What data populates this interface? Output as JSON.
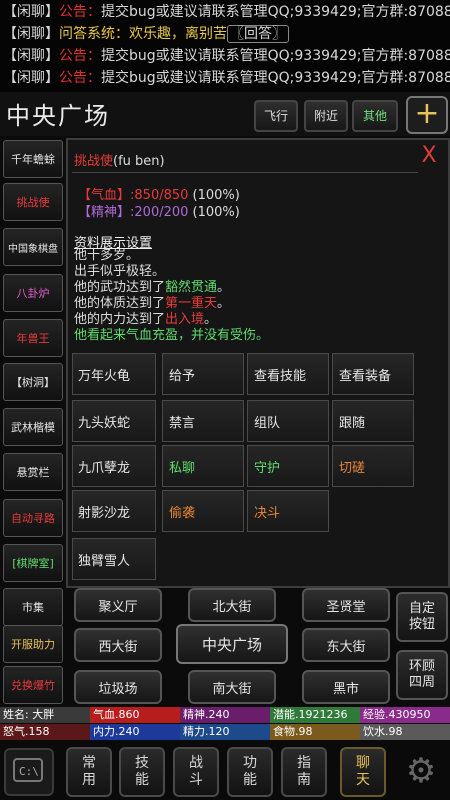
{
  "chat": [
    {
      "tag": "【闲聊】",
      "label": "公告：",
      "text": "提交bug或建议请联系管理QQ;9339429;官方群:87088"
    },
    {
      "tag": "【闲聊】",
      "label": "问答系统：",
      "text": "欢乐趣，离别苦",
      "highlight": "〖回答〗"
    },
    {
      "tag": "【闲聊】",
      "label": "公告：",
      "text": "提交bug或建议请联系管理QQ;9339429;官方群:87088"
    },
    {
      "tag": "【闲聊】",
      "label": "公告：",
      "text": "提交bug或建议请联系管理QQ;9339429;官方群:87088"
    }
  ],
  "location": {
    "title": "中央广场"
  },
  "header_buttons": {
    "fly": "飞行",
    "nearby": "附近",
    "other": "其他",
    "plus": "+"
  },
  "sidebar": [
    "千年蟾蜍",
    "挑战使",
    "中国象棋盘",
    "八卦炉",
    "年兽王",
    "【树洞】",
    "武林楷模",
    "悬赏栏",
    "自动寻路",
    "[棋牌室]",
    "市集",
    "开服助力",
    "兑换爆竹"
  ],
  "panel": {
    "close": "X",
    "npc_name": "挑战使",
    "npc_id": "(fu ben)",
    "hp_label": "【气血】",
    "hp_value": ":850/850",
    "hp_pct": "(100%)",
    "mp_label": "【精神】",
    "mp_value": ":200/200",
    "mp_pct": "(100%)",
    "profile_link": "资料展示设置",
    "info": [
      {
        "pre": "他十多岁。",
        "em": "",
        "post": ""
      },
      {
        "pre": "出手似乎极轻。",
        "em": "",
        "post": ""
      },
      {
        "pre": "他的武功达到了",
        "em": "豁然贯通",
        "post": "。"
      },
      {
        "pre": "他的体质达到了",
        "em": "第一重天",
        "post": "。"
      },
      {
        "pre": "他的内力达到了",
        "em": "出入境",
        "post": "。"
      },
      {
        "pre": "他看起来气血充盈，并没有受伤。",
        "em": "",
        "post": ""
      }
    ],
    "npcs": [
      "万年火龟",
      "九头妖蛇",
      "九爪孽龙",
      "射影沙龙",
      "独臂雪人"
    ],
    "actions": [
      [
        "给予",
        "查看技能",
        "查看装备"
      ],
      [
        "禁言",
        "组队",
        "跟随"
      ],
      [
        "私聊",
        "守护",
        "切磋"
      ],
      [
        "偷袭",
        "决斗",
        ""
      ]
    ]
  },
  "nav": {
    "juyiting": "聚义厅",
    "beidajie": "北大街",
    "shengxiantang": "圣贤堂",
    "xidajie": "西大街",
    "center": "中央广场",
    "dongdajie": "东大街",
    "lajichang": "垃圾场",
    "nandajie": "南大街",
    "heishi": "黑市",
    "custom": "自定\n按钮",
    "around": "环顾\n四周"
  },
  "status": {
    "name": "姓名: 大胖",
    "hp": "气血.860",
    "spirit": "精神.240",
    "potential": "潜能.1921236",
    "exp": "经验.430950",
    "anger": "怒气.158",
    "neili": "内力.240",
    "jingli": "精力.120",
    "food": "食物.98",
    "water": "饮水.98"
  },
  "bottom": [
    "常\n用",
    "技\n能",
    "战\n斗",
    "功\n能",
    "指\n南",
    "聊\n天"
  ]
}
